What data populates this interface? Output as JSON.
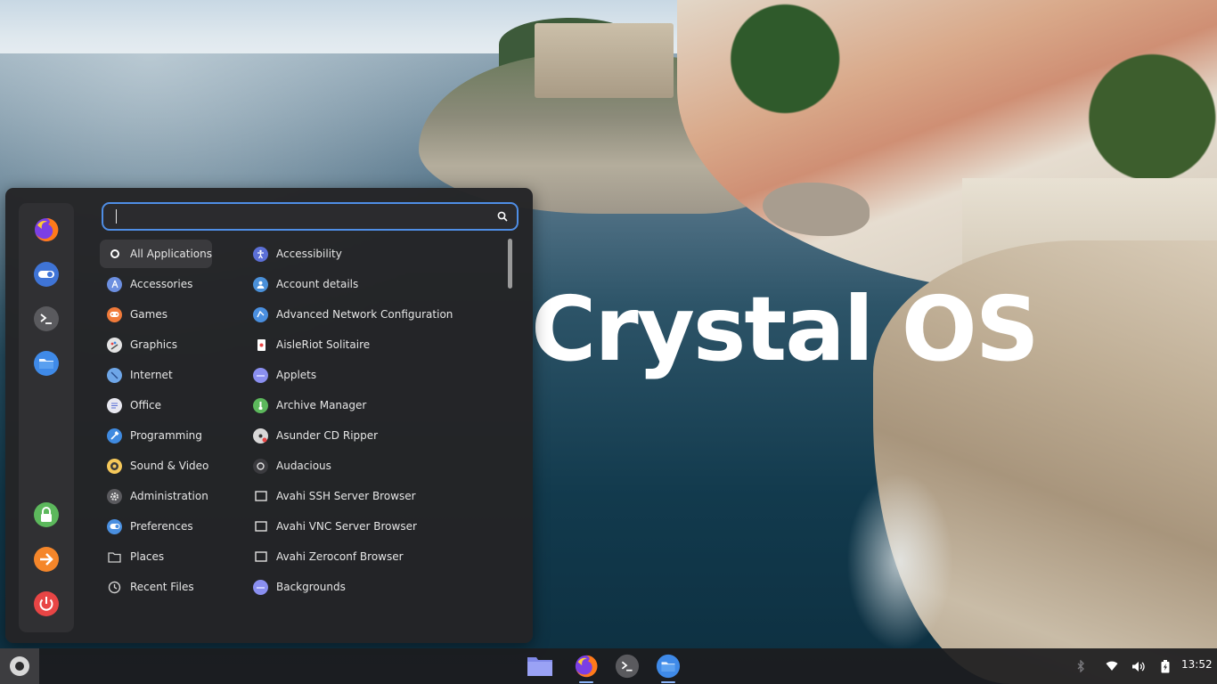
{
  "desktop": {
    "brand_text": "Crystal OS"
  },
  "menu": {
    "search": {
      "value": "",
      "placeholder": ""
    },
    "favorites": [
      {
        "name": "Firefox",
        "icon": "firefox-icon"
      },
      {
        "name": "Settings",
        "icon": "toggle-settings-icon"
      },
      {
        "name": "Terminal",
        "icon": "terminal-icon"
      },
      {
        "name": "Files",
        "icon": "folder-icon"
      }
    ],
    "session": [
      {
        "name": "Lock screen",
        "icon": "lock-icon",
        "color": "#5cb85c"
      },
      {
        "name": "Log out",
        "icon": "logout-arrow-icon",
        "color": "#f5862a"
      },
      {
        "name": "Shut down",
        "icon": "power-icon",
        "color": "#e84545"
      }
    ],
    "categories": [
      {
        "label": "All Applications",
        "icon": "circle-icon",
        "color": "#ffffff"
      },
      {
        "label": "Accessories",
        "icon": "accessories-icon",
        "color": "#6c8fe0"
      },
      {
        "label": "Games",
        "icon": "gamepad-icon",
        "color": "#f07a3a"
      },
      {
        "label": "Graphics",
        "icon": "palette-icon",
        "color": "#e4e4e4"
      },
      {
        "label": "Internet",
        "icon": "globe-icon",
        "color": "#6ea6e8"
      },
      {
        "label": "Office",
        "icon": "document-icon",
        "color": "#e8e8f0"
      },
      {
        "label": "Programming",
        "icon": "hammer-icon",
        "color": "#3f8ae0"
      },
      {
        "label": "Sound & Video",
        "icon": "speaker-icon",
        "color": "#f5c85a"
      },
      {
        "label": "Administration",
        "icon": "gear-icon",
        "color": "#cfcfcf"
      },
      {
        "label": "Preferences",
        "icon": "toggle-icon",
        "color": "#4a8fe0"
      },
      {
        "label": "Places",
        "icon": "folder-outline-icon",
        "color": "#d0d0d0"
      },
      {
        "label": "Recent Files",
        "icon": "clock-icon",
        "color": "#d0d0d0"
      }
    ],
    "apps": [
      {
        "label": "Accessibility",
        "icon": "accessibility-icon",
        "color": "#5b6fd6"
      },
      {
        "label": "Account details",
        "icon": "user-icon",
        "color": "#4a90d9"
      },
      {
        "label": "Advanced Network Configuration",
        "icon": "network-icon",
        "color": "#4a8fe0"
      },
      {
        "label": "AisleRiot Solitaire",
        "icon": "cards-icon",
        "color": "#ffffff"
      },
      {
        "label": "Applets",
        "icon": "applets-icon",
        "color": "#8a8ff0"
      },
      {
        "label": "Archive Manager",
        "icon": "archive-icon",
        "color": "#5cb85c"
      },
      {
        "label": "Asunder CD Ripper",
        "icon": "cd-icon",
        "color": "#d8d8d8"
      },
      {
        "label": "Audacious",
        "icon": "audacious-icon",
        "color": "#3b3b3f"
      },
      {
        "label": "Avahi SSH Server Browser",
        "icon": "window-icon",
        "color": "#e0e0e0"
      },
      {
        "label": "Avahi VNC Server Browser",
        "icon": "window-icon",
        "color": "#e0e0e0"
      },
      {
        "label": "Avahi Zeroconf Browser",
        "icon": "window-icon",
        "color": "#e0e0e0"
      },
      {
        "label": "Backgrounds",
        "icon": "backgrounds-icon",
        "color": "#8a8ff0"
      }
    ]
  },
  "taskbar": {
    "pinned": [
      {
        "name": "Files",
        "icon": "folder-icon"
      },
      {
        "name": "Firefox",
        "icon": "firefox-icon"
      },
      {
        "name": "Terminal",
        "icon": "terminal-icon"
      },
      {
        "name": "Files (blue)",
        "icon": "folder-icon"
      }
    ],
    "tray": [
      "bluetooth-icon",
      "wifi-icon",
      "volume-icon",
      "battery-icon"
    ],
    "clock": "13:52"
  }
}
